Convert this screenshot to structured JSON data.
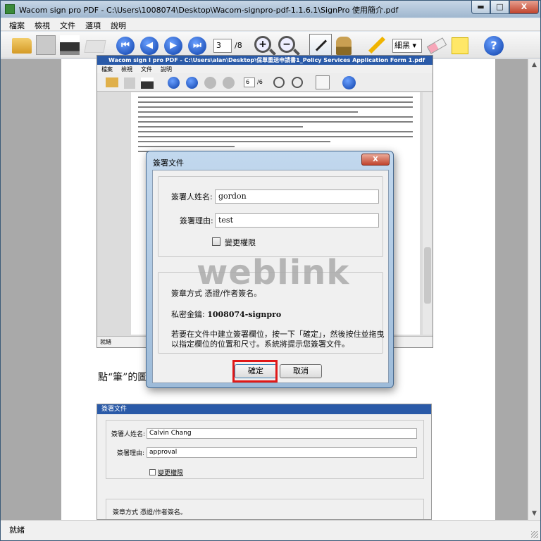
{
  "window": {
    "title": "Wacom sign pro PDF - C:\\Users\\1008074\\Desktop\\Wacom-signpro-pdf-1.1.6.1\\SignPro 使用簡介.pdf",
    "min_glyph": "▬",
    "max_glyph": "□",
    "close_glyph": "X"
  },
  "menu": [
    "檔案",
    "檢視",
    "文件",
    "選項",
    "說明"
  ],
  "toolbar": {
    "current_page": "3",
    "total_pages": "/8",
    "nav_first": "⏮",
    "nav_prev": "◀",
    "nav_next": "▶",
    "nav_last": "⏭",
    "zoom_in": "+",
    "zoom_out": "−",
    "line_width": "細黑",
    "help": "?"
  },
  "inner_window": {
    "title": "Wacom sign I pro PDF - C:\\Users\\alan\\Desktop\\保單重送申請書1_Policy Services Application Form 1.pdf",
    "menu": [
      "檔案",
      "檢視",
      "文件",
      "說明"
    ],
    "current_page": "6",
    "total_pages": "/6",
    "status": "就緒"
  },
  "caption": "點“筆”的圖",
  "dialog": {
    "title": "簽署文件",
    "close_label": "X",
    "signer_label": "簽署人姓名:",
    "signer_value": "gordon",
    "reason_label": "簽署理由:",
    "reason_value": "test",
    "change_permission_label": "變更權限",
    "method_text": "簽章方式 憑證/作者簽名。",
    "private_key_label": "私密金鑰:",
    "private_key_value": "1008074-signpro",
    "instruction_line1": "若要在文件中建立簽署欄位，按一下「確定」，然後按住並拖曳",
    "instruction_line2": "以指定欄位的位置和尺寸。系統將提示您簽署文件。",
    "ok_label": "確定",
    "cancel_label": "取消"
  },
  "watermark": "weblink",
  "lower_dialog": {
    "title": "簽署文件",
    "signer_label": "簽署人姓名:",
    "signer_value": "Calvin Chang",
    "reason_label": "簽署理由:",
    "reason_value": "approval",
    "change_permission_label": "變更權限",
    "method_text": "簽章方式 憑證/作者簽名。"
  },
  "status": "就緒",
  "colors": {
    "highlight_box": "#e01818",
    "title_bar_inner": "#2a5aa8"
  }
}
